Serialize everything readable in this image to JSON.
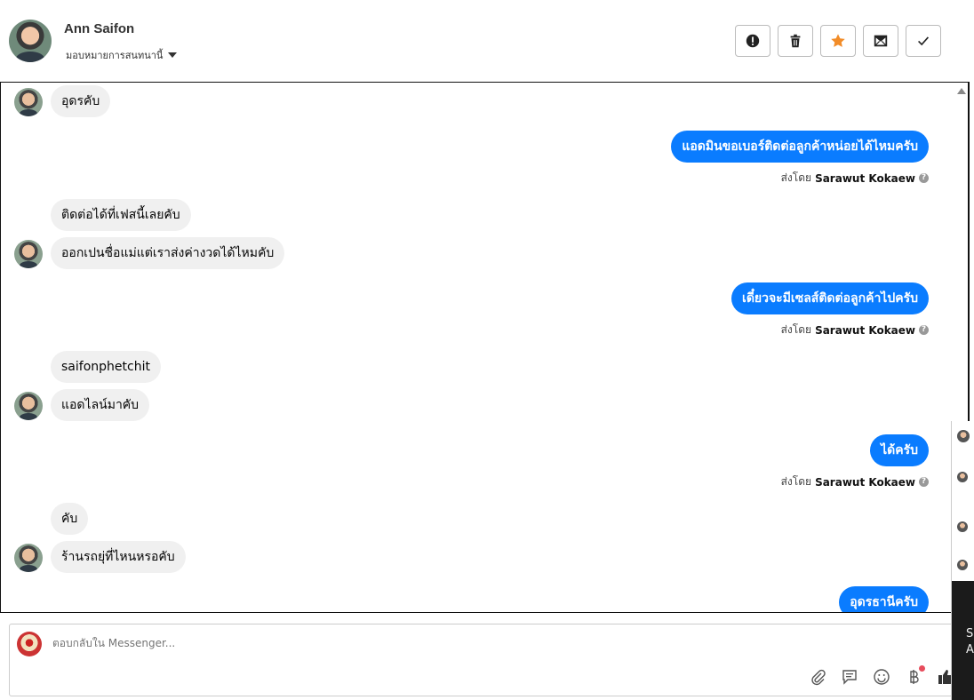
{
  "header": {
    "contact_name": "Ann Saifon",
    "assign_label": "มอบหมายการสนทนานี้",
    "actions": [
      {
        "name": "spam-button",
        "icon": "exclamation-icon"
      },
      {
        "name": "delete-button",
        "icon": "trash-icon"
      },
      {
        "name": "star-button",
        "icon": "star-icon"
      },
      {
        "name": "mark-unread-button",
        "icon": "envelope-icon"
      },
      {
        "name": "done-button",
        "icon": "check-icon"
      }
    ],
    "star_color": "#f28c28"
  },
  "messages": {
    "m1": "อุดรคับ",
    "m2": "แอดมินขอเบอร์ติดต่อลูกค้าหน่อยได้ไหมครับ",
    "m3": "ติดต่อได้ที่เฟสนี้เลยคับ",
    "m4": "ออกเปนชื่อแม่แต่เราส่งค่างวดได้ไหมคับ",
    "m5": "เดี๋ยวจะมีเซลส์ติดต่อลูกค้าไปครับ",
    "m6": "saifonphetchit",
    "m7": "แอดไลน์มาคับ",
    "m8": "ได้ครับ",
    "m9": "คับ",
    "m10": "ร้านรถยุ่ที่ไหนหรอคับ",
    "m11": "อุดรธานีครับ"
  },
  "sent_by": {
    "prefix": "ส่งโดย",
    "agent": "Sarawut Kokaew",
    "help": "?"
  },
  "composer": {
    "placeholder": "ตอบกลับใน Messenger..."
  },
  "side_peek": {
    "text1": "Sc",
    "text2": "A"
  },
  "colors": {
    "outgoing_bubble": "#0a7cff",
    "incoming_bubble": "#f0f0f0"
  }
}
